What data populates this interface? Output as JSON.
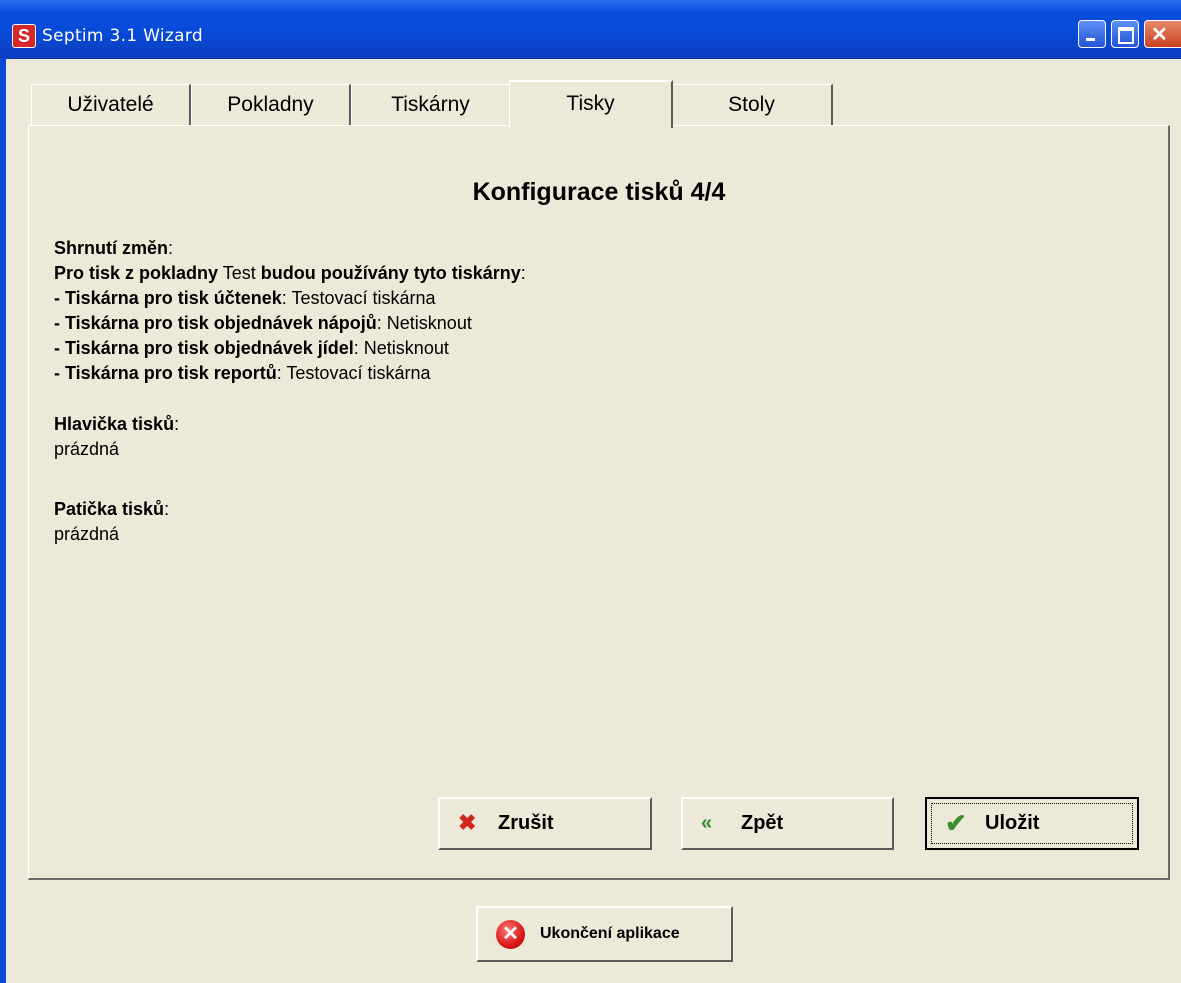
{
  "window": {
    "title": "Septim 3.1 Wizard",
    "app_icon_letter": "S"
  },
  "tabs": [
    {
      "label": "Uživatelé"
    },
    {
      "label": "Pokladny"
    },
    {
      "label": "Tiskárny"
    },
    {
      "label": "Tisky",
      "active": true
    },
    {
      "label": "Stoly"
    }
  ],
  "content": {
    "heading": "Konfigurace tisků 4/4",
    "summary_label": "Shrnutí změn",
    "intro_prefix": "Pro tisk z pokladny",
    "intro_register": "Test",
    "intro_suffix": "budou používány tyto tiskárny",
    "printers": [
      {
        "label": "- Tiskárna pro tisk účtenek",
        "value": "Testovací tiskárna"
      },
      {
        "label": "- Tiskárna pro tisk objednávek nápojů",
        "value": "Netisknout"
      },
      {
        "label": "- Tiskárna pro tisk objednávek jídel",
        "value": "Netisknout"
      },
      {
        "label": "- Tiskárna pro tisk reportů",
        "value": "Testovací tiskárna"
      }
    ],
    "header_label": "Hlavička tisků",
    "header_value": "prázdná",
    "footer_label": "Patička tisků",
    "footer_value": "prázdná"
  },
  "buttons": {
    "cancel": "Zrušit",
    "back": "Zpět",
    "save": "Uložit",
    "exit": "Ukončení aplikace"
  },
  "colors": {
    "titlebar": "#0a4fe0",
    "window_bg": "#ece9d8",
    "cancel_icon": "#d4251c",
    "back_icon": "#3a8a2a",
    "save_icon": "#3f8f2e"
  }
}
